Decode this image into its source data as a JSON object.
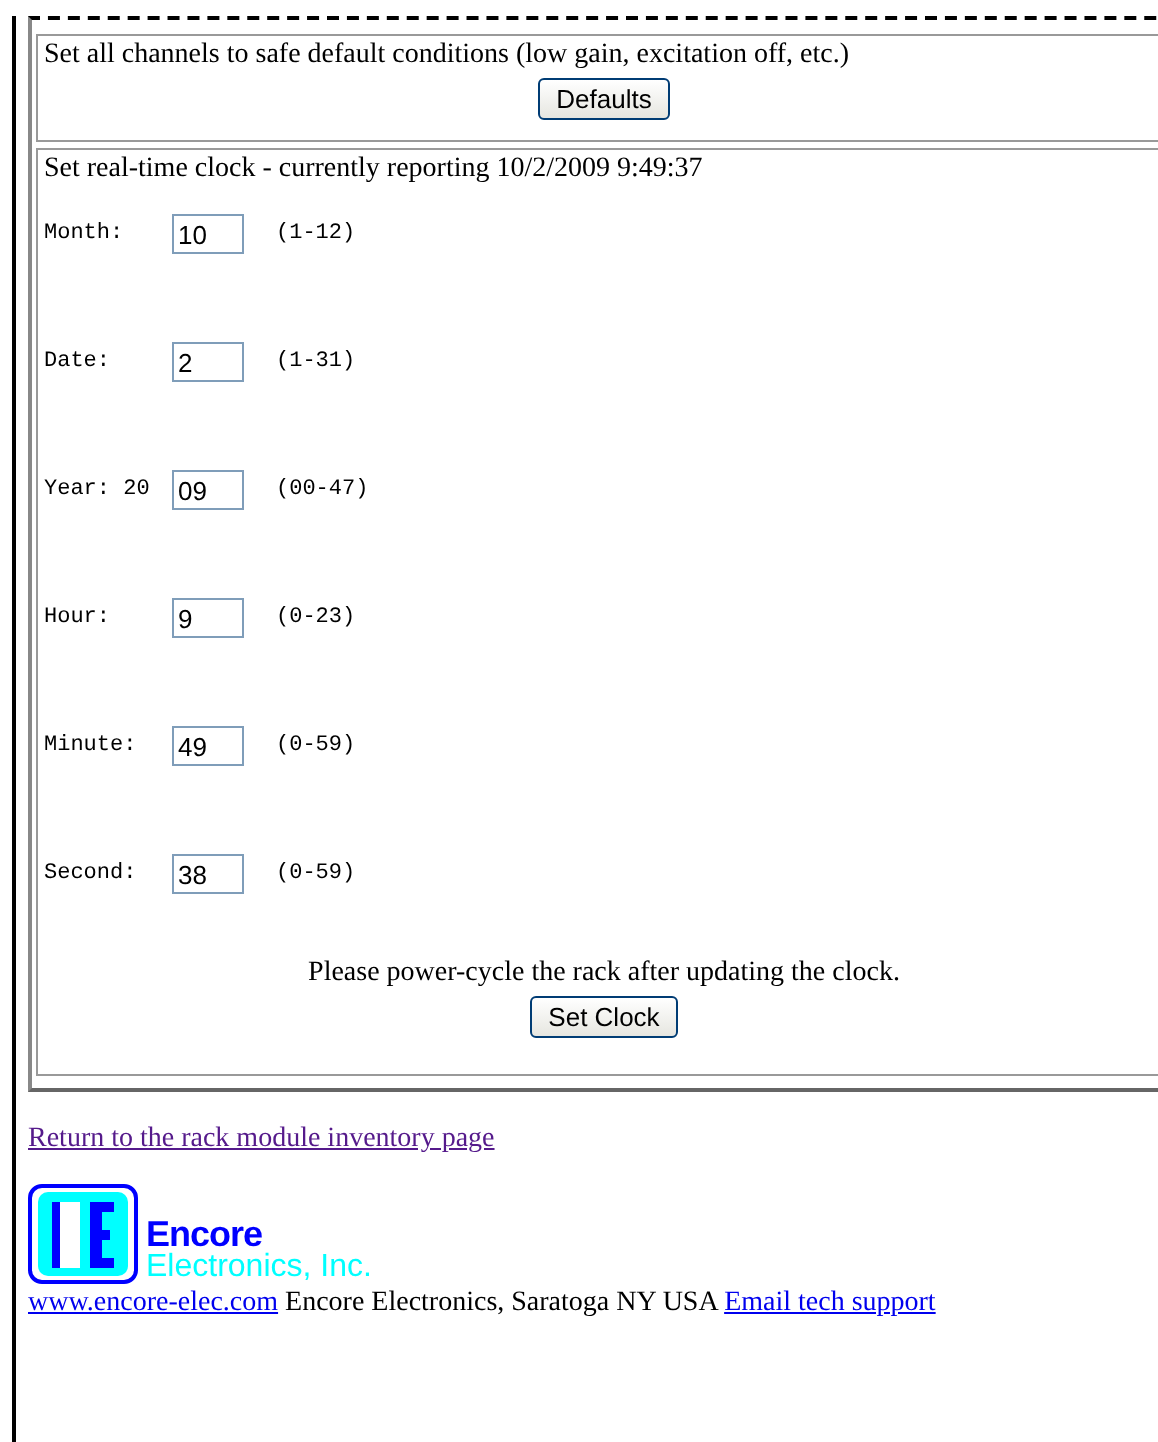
{
  "defaults_section": {
    "text": "Set all channels to safe default conditions (low gain, excitation off, etc.)",
    "button": "Defaults"
  },
  "clock_section": {
    "title": "Set real-time clock - currently reporting 10/2/2009 9:49:37",
    "fields": [
      {
        "label": "Month:",
        "value": "10",
        "range": "(1-12)"
      },
      {
        "label": "Date:",
        "value": "2",
        "range": "(1-31)"
      },
      {
        "label": "Year: 20",
        "value": "09",
        "range": "(00-47)"
      },
      {
        "label": "Hour:",
        "value": "9",
        "range": "(0-23)"
      },
      {
        "label": "Minute:",
        "value": "49",
        "range": "(0-59)"
      },
      {
        "label": "Second:",
        "value": "38",
        "range": "(0-59)"
      }
    ],
    "note": "Please power-cycle the rack after updating the clock.",
    "button": "Set Clock"
  },
  "return_link": "Return to the rack module inventory page",
  "logo": {
    "name": "Encore",
    "subtitle": "Electronics, Inc."
  },
  "footer": {
    "website_link": "www.encore-elec.com",
    "text": "Encore Electronics, Saratoga NY USA",
    "email_link": "Email tech support"
  }
}
